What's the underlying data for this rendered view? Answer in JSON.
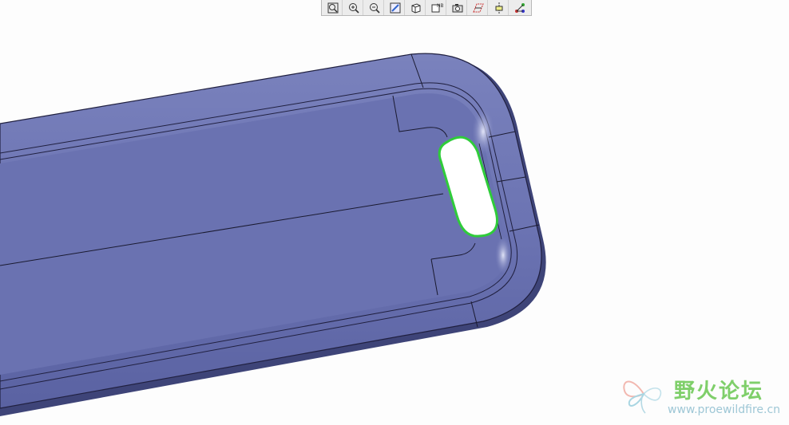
{
  "toolbar": {
    "buttons": [
      {
        "name": "zoom-fit-icon"
      },
      {
        "name": "zoom-in-icon"
      },
      {
        "name": "zoom-out-icon"
      },
      {
        "name": "repaint-icon"
      },
      {
        "name": "display-style-icon"
      },
      {
        "name": "saved-views-icon"
      },
      {
        "name": "camera-icon"
      },
      {
        "name": "datum-planes-icon"
      },
      {
        "name": "datum-axes-icon"
      },
      {
        "name": "spin-center-icon"
      }
    ]
  },
  "model": {
    "body_color": "#6f78b6",
    "edge_color": "#1a1a30",
    "selection_color": "#2fcc3a"
  },
  "watermark": {
    "cn_text": "野火论坛",
    "url_text": "www.proewildfire.cn",
    "text_color": "#7fcf6a",
    "url_color": "#9ec7d6"
  }
}
